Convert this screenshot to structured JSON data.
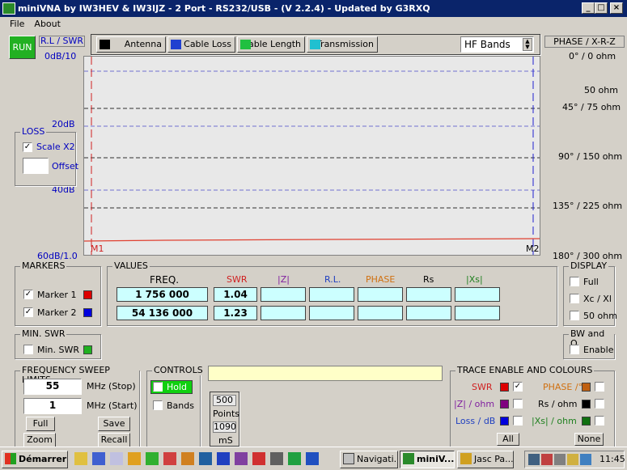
{
  "window": {
    "title": "miniVNA by IW3HEV & IW3IJZ - 2 Port - RS232/USB - (V 2.2.4) - Updated by G3RXQ"
  },
  "menu": [
    "File",
    "About"
  ],
  "run_label": "RUN",
  "rl_swr_label": "R.L / SWR",
  "modes": {
    "antenna": "Antenna",
    "cable_loss": "Cable Loss",
    "cable_length": "Cable Length",
    "transmission": "Transmission"
  },
  "band_select": "HF Bands",
  "phase_header": "PHASE / X-R-Z",
  "left_axis": [
    "0dB/10",
    "20dB",
    "40dB",
    "60dB/1.0"
  ],
  "right_axis": [
    "0° / 0 ohm",
    "50 ohm",
    "45° / 75 ohm",
    "90° / 150 ohm",
    "135° / 225 ohm",
    "180° / 300 ohm"
  ],
  "plot_markers": {
    "m1": "M1",
    "m2": "M2"
  },
  "loss": {
    "title": "LOSS",
    "scale_label": "Scale X2",
    "scale_checked": "✓",
    "offset_label": "Offset",
    "offset_value": ""
  },
  "markers": {
    "title": "MARKERS",
    "m1": "Marker 1",
    "m2": "Marker 2",
    "m1_checked": "✓",
    "m2_checked": "✓",
    "m1_color": "#dd0000",
    "m2_color": "#0000dd"
  },
  "values": {
    "title": "VALUES",
    "headers": [
      "FREQ.",
      "SWR",
      "|Z|",
      "R.L.",
      "PHASE",
      "Rs",
      "|Xs|"
    ],
    "rows": [
      {
        "freq": "1 756 000",
        "swr": "1.04"
      },
      {
        "freq": "54 136 000",
        "swr": "1.23"
      }
    ]
  },
  "display": {
    "title": "DISPLAY",
    "full": "Full",
    "xc_xl": "Xc / Xl",
    "ohm50": "50 ohm"
  },
  "bwq": {
    "title": "BW and Q",
    "enable": "Enable"
  },
  "min_swr": {
    "title": "MIN. SWR",
    "label": "Min. SWR"
  },
  "sweep": {
    "title": "FREQUENCY SWEEP LIMITS",
    "stop_value": "55",
    "stop_label": "MHz  (Stop)",
    "start_value": "1",
    "start_label": "MHz  (Start)",
    "full": "Full",
    "save": "Save",
    "zoom": "Zoom",
    "recall": "Recall"
  },
  "controls": {
    "title": "CONTROLS",
    "hold": "Hold",
    "bands": "Bands"
  },
  "points": {
    "points_value": "500",
    "points_label": "Points",
    "ms_value": "1090",
    "ms_label": "mS"
  },
  "trace": {
    "title": "TRACE ENABLE AND COLOURS",
    "swr": "SWR",
    "swr_checked": "✓",
    "z": "|Z| / ohm",
    "loss": "Loss / dB",
    "phase": "PHASE /°",
    "rs": "Rs / ohm",
    "xs": "|Xs| / ohm",
    "all": "All",
    "none": "None"
  },
  "taskbar": {
    "start": "Démarrer",
    "tasks": [
      "Navigati...",
      "miniV...",
      "Jasc Pa..."
    ],
    "clock": "11:45"
  }
}
